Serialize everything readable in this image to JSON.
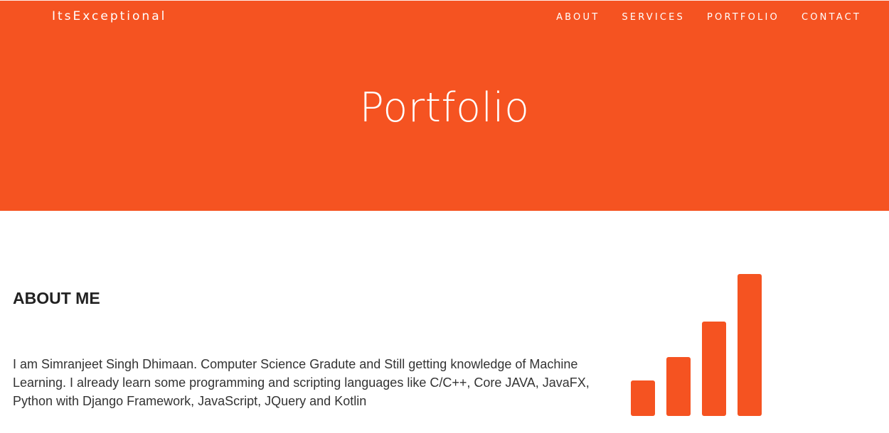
{
  "header": {
    "brand": "ItsExceptional",
    "nav": [
      {
        "label": "ABOUT"
      },
      {
        "label": "SERVICES"
      },
      {
        "label": "PORTFOLIO"
      },
      {
        "label": "CONTACT"
      }
    ]
  },
  "hero": {
    "title": "Portfolio"
  },
  "about": {
    "title": "ABOUT ME",
    "text": "I am Simranjeet Singh Dhimaan. Computer Science Gradute and Still getting knowledge of Machine Learning. I already learn some programming and scripting languages like C/C++, Core JAVA, JavaFX, Python with Django Framework, JavaScript, JQuery and Kotlin"
  },
  "icons": {
    "about_illustration": "signal-bars-icon"
  },
  "colors": {
    "accent": "#f55321",
    "text": "#222222",
    "background": "#ffffff"
  }
}
